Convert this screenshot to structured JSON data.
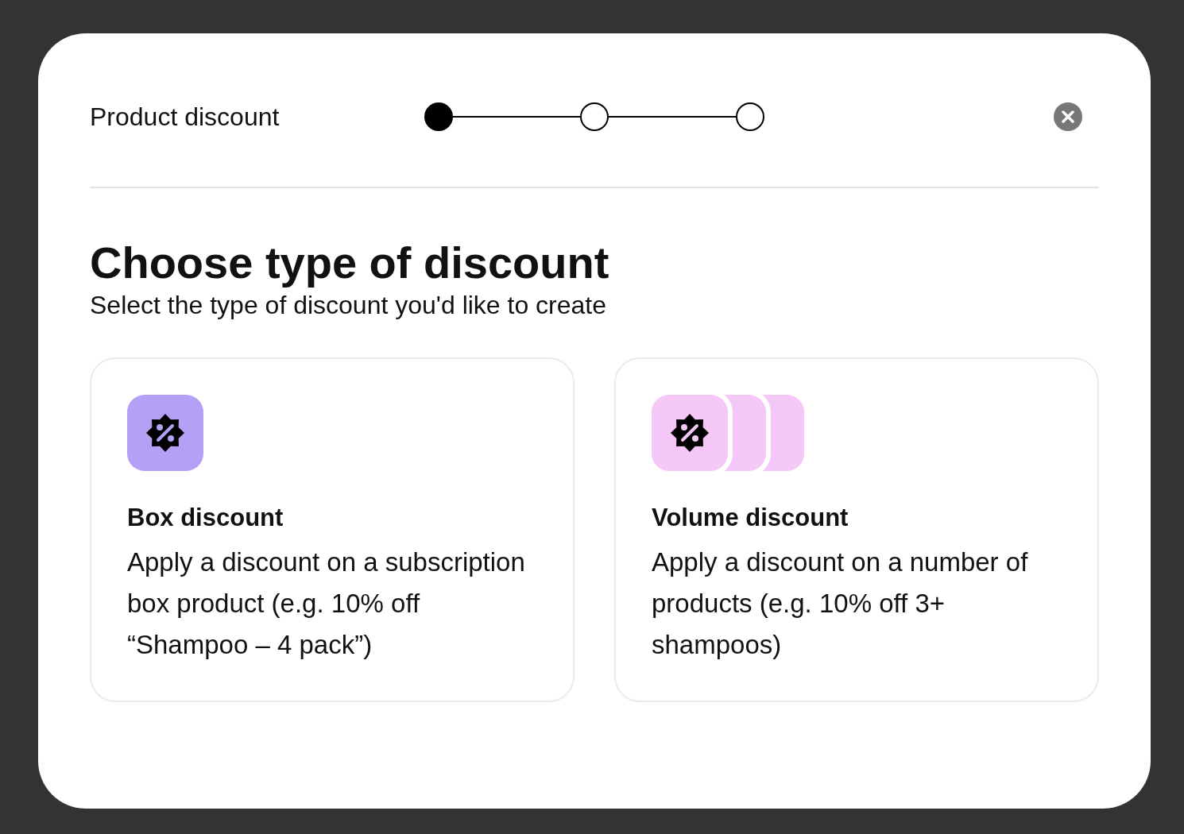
{
  "dialog": {
    "title": "Product discount",
    "stepper": {
      "steps": [
        {
          "selected": true
        },
        {
          "selected": false
        },
        {
          "selected": false
        }
      ]
    },
    "heading": "Choose type of discount",
    "subheading": "Select the type of discount you'd like to create",
    "options": [
      {
        "kind": "single",
        "color": "#b4a0f5",
        "title": "Box discount",
        "description": "Apply a discount on a subscription box product (e.g. 10% off “Shampoo – 4 pack”)"
      },
      {
        "kind": "stacked",
        "color": "#f5c7f7",
        "title": "Volume discount",
        "description": "Apply a discount on a number of products (e.g. 10% off 3+ shampoos)"
      }
    ]
  }
}
